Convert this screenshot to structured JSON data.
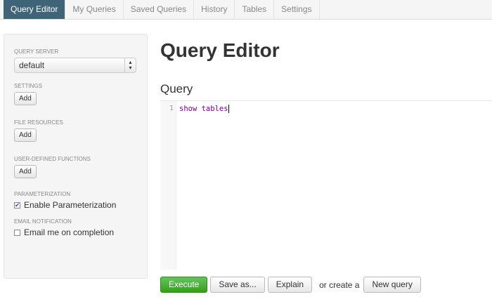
{
  "nav": {
    "tabs": [
      "Query Editor",
      "My Queries",
      "Saved Queries",
      "History",
      "Tables",
      "Settings"
    ]
  },
  "sidebar": {
    "query_server_label": "Query Server",
    "query_server_value": "default",
    "settings_label": "Settings",
    "file_resources_label": "File Resources",
    "udf_label": "User-Defined Functions",
    "add_label": "Add",
    "param_label": "Parameterization",
    "param_checkbox": "Enable Parameterization",
    "param_checked": true,
    "email_label": "Email Notification",
    "email_checkbox": "Email me on completion",
    "email_checked": false
  },
  "main": {
    "title": "Query Editor",
    "section": "Query",
    "line_number": "1",
    "query": "show tables"
  },
  "actions": {
    "execute": "Execute",
    "save_as": "Save as...",
    "explain": "Explain",
    "or_text": "or create a",
    "new_query": "New query"
  }
}
